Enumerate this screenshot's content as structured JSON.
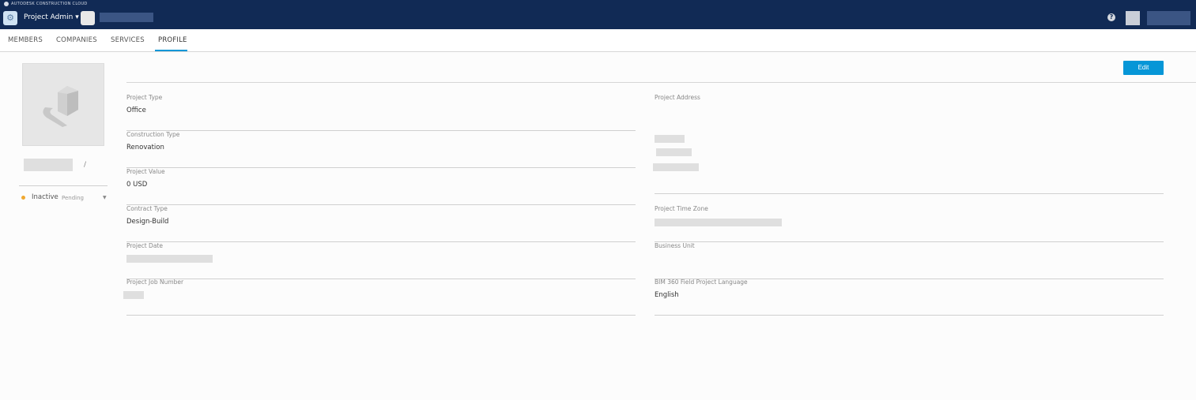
{
  "header": {
    "brand": "AUTODESK CONSTRUCTION CLOUD",
    "app_name": "Project Admin ▾",
    "help": "?"
  },
  "tabs": [
    {
      "label": "MEMBERS"
    },
    {
      "label": "COMPANIES"
    },
    {
      "label": "SERVICES"
    },
    {
      "label": "PROFILE"
    }
  ],
  "sidebar": {
    "status": "Inactive",
    "substatus": "Pending"
  },
  "edit_label": "Edit",
  "left_fields": [
    {
      "label": "Project Type",
      "value": "Office"
    },
    {
      "label": "Construction Type",
      "value": "Renovation"
    },
    {
      "label": "Project Value",
      "value": "0 USD"
    },
    {
      "label": "Contract Type",
      "value": "Design-Build"
    },
    {
      "label": "Project Date",
      "value": ""
    },
    {
      "label": "Project Job Number",
      "value": ""
    }
  ],
  "right_fields": [
    {
      "label": "Project Address",
      "value": ""
    },
    {
      "label": "Project Time Zone",
      "value": ""
    },
    {
      "label": "Business Unit",
      "value": ""
    },
    {
      "label": "BIM 360 Field Project Language",
      "value": "English"
    }
  ]
}
